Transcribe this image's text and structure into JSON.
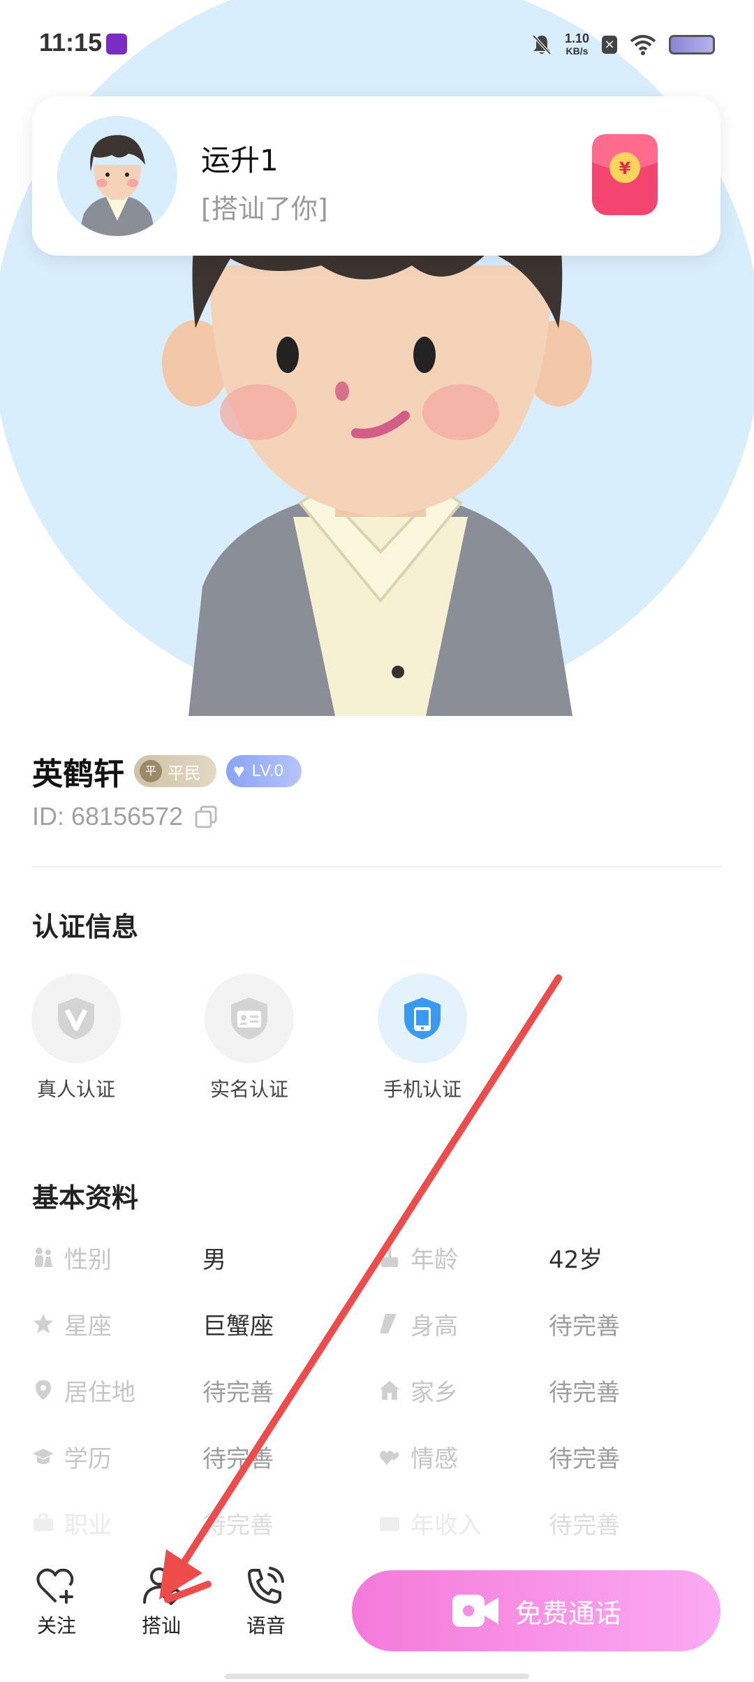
{
  "status_bar": {
    "time": "11:15",
    "net_speed_value": "1.10",
    "net_speed_unit": "KB/s",
    "icons": [
      "app-icon",
      "bell-muted-icon",
      "close-badge-icon",
      "wifi-icon",
      "battery-icon"
    ]
  },
  "notification": {
    "sender": "运升1",
    "message": "[搭讪了你]",
    "icon": "red-envelope-icon"
  },
  "profile": {
    "name": "英鹤轩",
    "rank_badge": "平民",
    "rank_badge_coin": "平",
    "level_badge": "LV.0",
    "id_text": "ID: 68156572"
  },
  "verification": {
    "title": "认证信息",
    "items": [
      {
        "label": "真人认证",
        "icon": "verified-v-icon",
        "active": false
      },
      {
        "label": "实名认证",
        "icon": "id-card-icon",
        "active": false
      },
      {
        "label": "手机认证",
        "icon": "phone-icon",
        "active": true
      }
    ]
  },
  "basic_info": {
    "title": "基本资料",
    "rows": [
      [
        {
          "key": "性别",
          "icon": "gender-icon",
          "value": "男",
          "pending": false
        },
        {
          "key": "年龄",
          "icon": "cake-icon",
          "value": "42岁",
          "pending": false
        }
      ],
      [
        {
          "key": "星座",
          "icon": "star-icon",
          "value": "巨蟹座",
          "pending": false
        },
        {
          "key": "身高",
          "icon": "ruler-icon",
          "value": "待完善",
          "pending": true
        }
      ],
      [
        {
          "key": "居住地",
          "icon": "location-icon",
          "value": "待完善",
          "pending": true
        },
        {
          "key": "家乡",
          "icon": "home-icon",
          "value": "待完善",
          "pending": true
        }
      ],
      [
        {
          "key": "学历",
          "icon": "grad-cap-icon",
          "value": "待完善",
          "pending": true
        },
        {
          "key": "情感",
          "icon": "hearts-icon",
          "value": "待完善",
          "pending": true
        }
      ],
      [
        {
          "key": "职业",
          "icon": "briefcase-icon",
          "value": "待完善",
          "pending": true
        },
        {
          "key": "年收入",
          "icon": "wallet-icon",
          "value": "待完善",
          "pending": true
        }
      ]
    ]
  },
  "bottom_bar": {
    "follow": "关注",
    "chat_up": "搭讪",
    "voice": "语音",
    "call": "免费通话"
  },
  "colors": {
    "accent_pink": "#f47ad9",
    "arrow_red": "#ee4b4b",
    "hero_bg": "#d9eefc",
    "phone_cert_blue": "#3a9af0"
  }
}
